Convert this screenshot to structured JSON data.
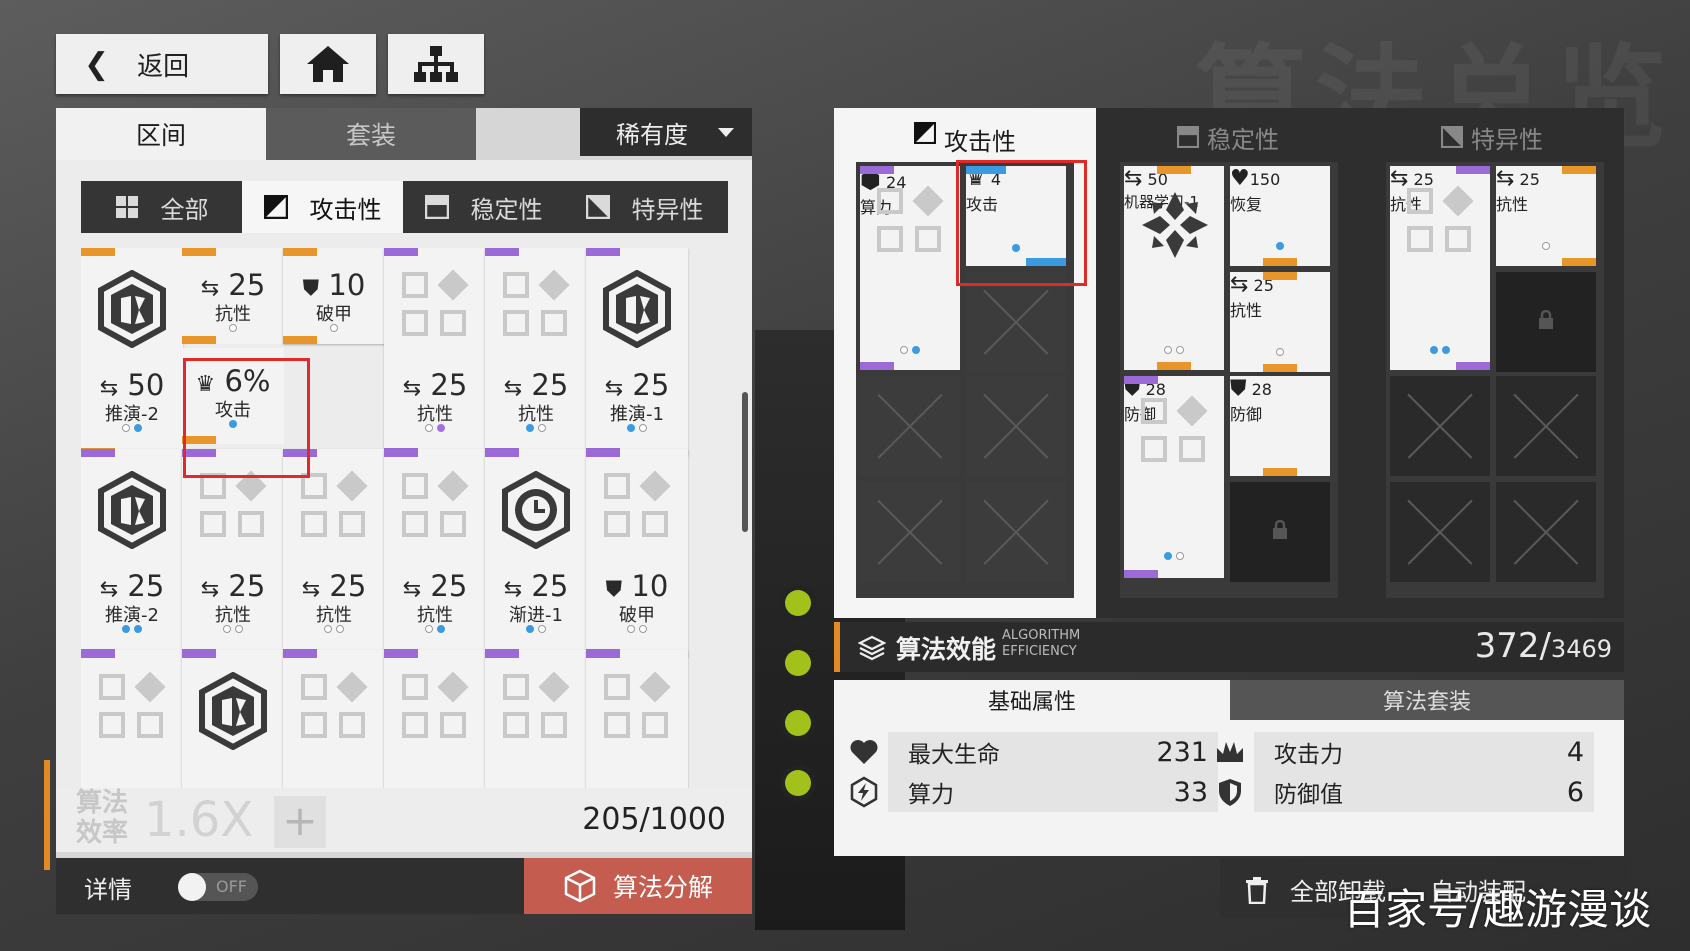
{
  "header": {
    "back_label": "返回",
    "home_icon": "home-icon",
    "tree_icon": "hierarchy-icon",
    "bg_title": "算法总览"
  },
  "left_tabs": {
    "range": "区间",
    "suit": "套装",
    "rarity": "稀有度"
  },
  "filters": [
    "全部",
    "攻击性",
    "稳定性",
    "特异性"
  ],
  "filter_active": 1,
  "cards": [
    {
      "band": "orange",
      "icon": "hex-shield-icon",
      "value": "50",
      "label": "推演-2",
      "stat_icon": "arrows-icon",
      "dots": [
        "e",
        "f"
      ]
    },
    {
      "band": "orange",
      "split": true,
      "top": {
        "value": "25",
        "label": "抗性",
        "stat_icon": "arrows-icon"
      },
      "bottom": {
        "value": "6%",
        "label": "攻击",
        "stat_icon": "crown-icon"
      }
    },
    {
      "band": "orange",
      "half": true,
      "value": "10",
      "label": "破甲",
      "stat_icon": "shield-icon"
    },
    {
      "band": "purple",
      "icon": "placeholder",
      "value": "25",
      "label": "抗性",
      "stat_icon": "arrows-icon",
      "dots": [
        "e",
        "p"
      ]
    },
    {
      "band": "purple",
      "icon": "placeholder",
      "value": "25",
      "label": "抗性",
      "stat_icon": "arrows-icon",
      "dots": [
        "f",
        "e"
      ]
    },
    {
      "band": "purple",
      "icon": "hex-shield-icon",
      "value": "25",
      "label": "推演-1",
      "stat_icon": "arrows-icon",
      "dots": [
        "f",
        "e"
      ]
    },
    {
      "band": "purple",
      "icon": "hex-shield-icon",
      "value": "25",
      "label": "推演-2",
      "stat_icon": "arrows-icon",
      "dots": [
        "f",
        "f"
      ]
    },
    {
      "band": "purple",
      "icon": "placeholder",
      "value": "25",
      "label": "抗性",
      "stat_icon": "arrows-icon",
      "dots": [
        "e",
        "e"
      ]
    },
    {
      "band": "purple",
      "icon": "placeholder",
      "value": "25",
      "label": "抗性",
      "stat_icon": "arrows-icon",
      "dots": [
        "e",
        "e"
      ]
    },
    {
      "band": "purple",
      "icon": "placeholder",
      "value": "25",
      "label": "抗性",
      "stat_icon": "arrows-icon",
      "dots": [
        "e",
        "f"
      ]
    },
    {
      "band": "purple",
      "icon": "hex-clock-icon",
      "value": "25",
      "label": "渐进-1",
      "stat_icon": "arrows-icon",
      "dots": [
        "f",
        "e"
      ]
    },
    {
      "band": "purple",
      "icon": "placeholder",
      "value": "10",
      "label": "破甲",
      "stat_icon": "shield-icon",
      "dots": [
        "e",
        "e"
      ]
    },
    {
      "band": "purple",
      "icon": "placeholder"
    },
    {
      "band": "purple",
      "icon": "hex-shield-icon"
    },
    {
      "band": "purple",
      "icon": "placeholder"
    },
    {
      "band": "purple",
      "icon": "placeholder"
    },
    {
      "band": "purple",
      "icon": "placeholder"
    },
    {
      "band": "purple",
      "icon": "placeholder"
    }
  ],
  "left_bottom": {
    "eff_label": "算法\n效率",
    "eff_value": "1.6X",
    "capacity": "205/1000"
  },
  "details": {
    "label": "详情",
    "toggle": "OFF",
    "decompose": "算法分解"
  },
  "right_tabs": [
    "攻击性",
    "稳定性",
    "特异性"
  ],
  "attack_slots": {
    "big": {
      "value": "24",
      "label": "算力",
      "stat_icon": "hex-bolt-icon"
    },
    "small": {
      "value": "4",
      "label": "攻击",
      "stat_icon": "crown-icon"
    }
  },
  "stability_slots": {
    "big_top": {
      "value": "50",
      "label": "机器学习-1",
      "stat_icon": "arrows-icon"
    },
    "s1": {
      "value": "150",
      "label": "恢复",
      "stat_icon": "heart-icon"
    },
    "s2": {
      "value": "25",
      "label": "抗性",
      "stat_icon": "arrows-icon"
    },
    "s3": {
      "value": "28",
      "label": "防御",
      "stat_icon": "shield-icon"
    },
    "big_bot": {
      "value": "28",
      "label": "防御",
      "stat_icon": "shield-icon"
    }
  },
  "special_slots": {
    "big": {
      "value": "25",
      "label": "抗性",
      "stat_icon": "arrows-icon"
    },
    "small": {
      "value": "25",
      "label": "抗性",
      "stat_icon": "arrows-icon"
    }
  },
  "efficiency": {
    "title": "算法效能",
    "sub1": "ALGORITHM",
    "sub2": "EFFICIENCY",
    "value": "372/",
    "max": "3469"
  },
  "sub_tabs": {
    "basic": "基础属性",
    "suit": "算法套装"
  },
  "stats": [
    {
      "name": "最大生命",
      "value": "231",
      "icon": "heart-icon"
    },
    {
      "name": "算力",
      "value": "33",
      "icon": "hex-bolt-icon"
    },
    {
      "name": "攻击力",
      "value": "4",
      "icon": "crown-icon"
    },
    {
      "name": "防御值",
      "value": "6",
      "icon": "shield-icon"
    }
  ],
  "bottom_right": {
    "uninstall": "全部卸载",
    "auto": "自动装配"
  },
  "watermark": "百家号/趣游漫谈",
  "colors": {
    "orange": "#e8962a",
    "purple": "#9b6ad6",
    "blue": "#3a9be0",
    "red_highlight": "#e02a2a",
    "decompose": "#c45c4f"
  }
}
